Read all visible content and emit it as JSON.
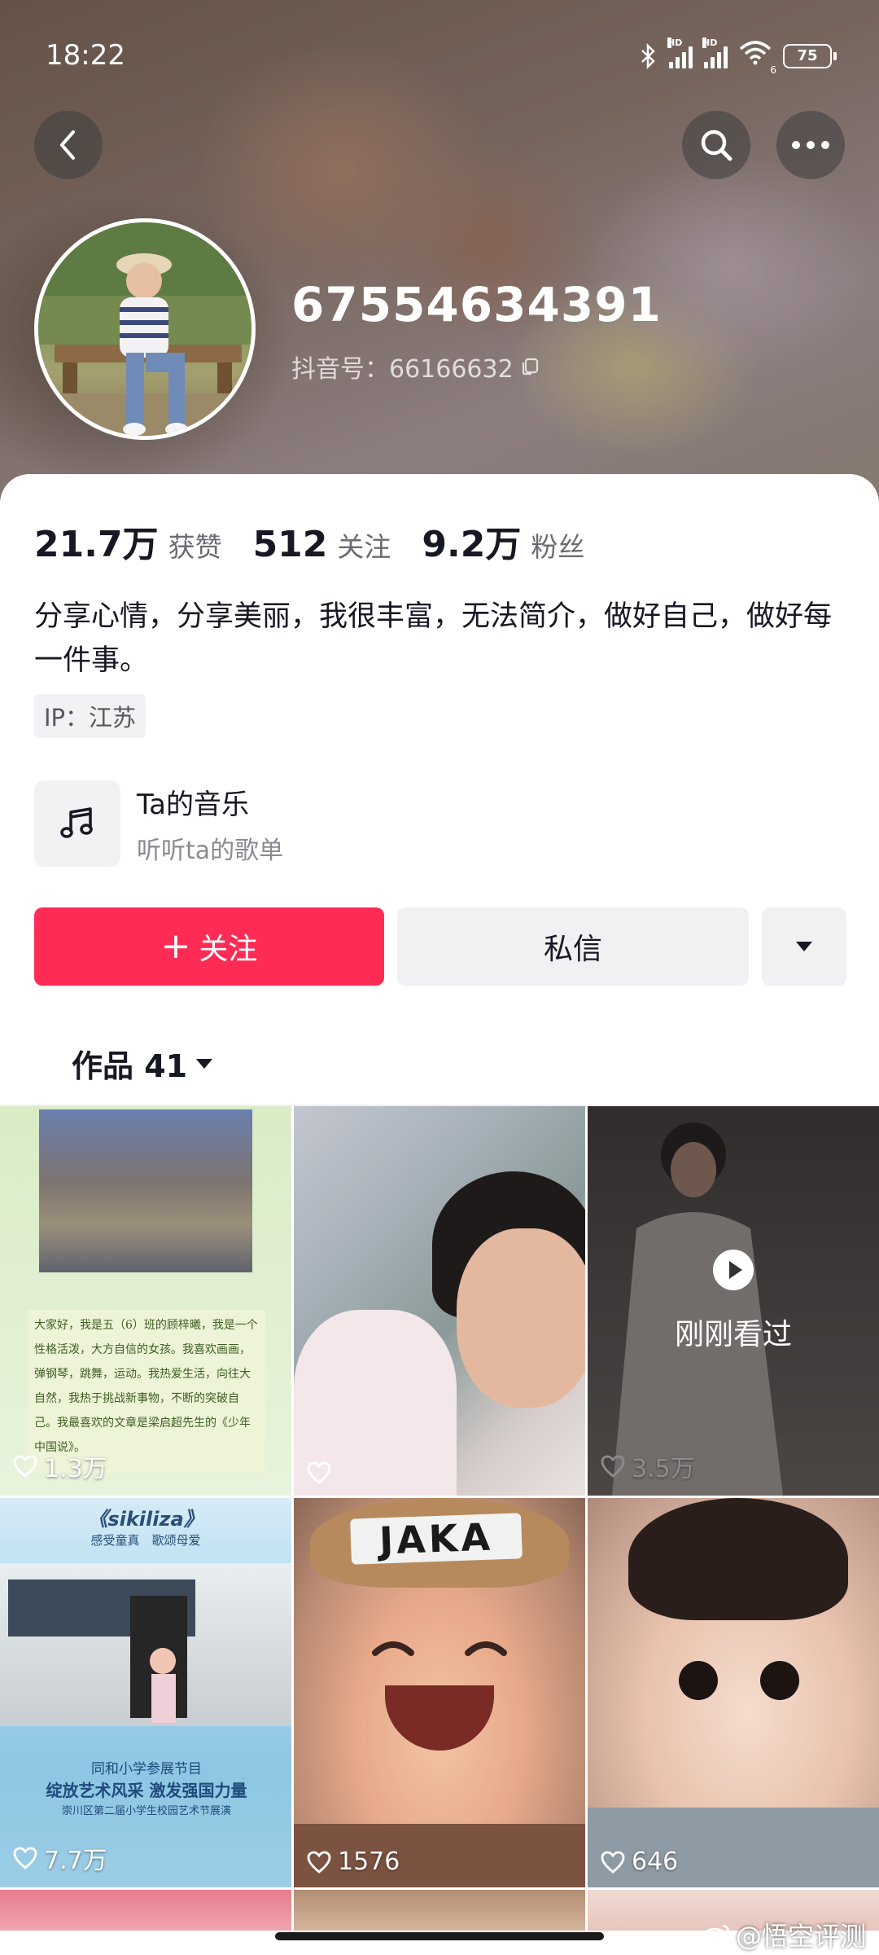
{
  "status_bar": {
    "time": "18:22",
    "battery": "75",
    "signal_1_label": "HD",
    "signal_2_label": "HD",
    "wifi_label": "6"
  },
  "profile": {
    "nickname": "67554634391",
    "douyin_id": "抖音号：66166632",
    "stats": [
      {
        "value": "21.7万",
        "label": "获赞"
      },
      {
        "value": "512",
        "label": "关注"
      },
      {
        "value": "9.2万",
        "label": "粉丝"
      }
    ],
    "bio": "分享心情，分享美丽，我很丰富，无法简介，做好自己，做好每一件事。",
    "ip": "IP：江苏"
  },
  "music": {
    "title": "Ta的音乐",
    "subtitle": "听听ta的歌单"
  },
  "actions": {
    "follow_label": "关注",
    "follow_icon": "+",
    "message_label": "私信"
  },
  "works": {
    "tab_label": "作品 41"
  },
  "tiles": [
    {
      "likes": "1.3万",
      "paper_text": "大家好，我是五（6）班的顾梓曦，我是一个性格活泼，大方自信的女孩。我喜欢画画，弹钢琴，跳舞，运动。我热爱生活，向往大自然，我热于挑战新事物，不断的突破自己。我最喜欢的文章是梁启超先生的《少年中国说》。"
    },
    {
      "likes": ""
    },
    {
      "likes": "3.5万",
      "overlay_text": "刚刚看过"
    },
    {
      "likes": "7.7万",
      "banner_text": "《sikiliza》",
      "banner_sub": "感受童真　歌颂母爱",
      "caption_1": "同和小学参展节目",
      "caption_2": "绽放艺术风采 激发强国力量",
      "caption_3": "崇川区第二届小学生校园艺术节展演"
    },
    {
      "likes": "1576",
      "hat_text": "JAKA"
    },
    {
      "likes": "646"
    }
  ],
  "watermark": "@悟空评测",
  "colors": {
    "accent": "#fe2c55",
    "text": "#161823",
    "muted": "#6b6b73"
  }
}
